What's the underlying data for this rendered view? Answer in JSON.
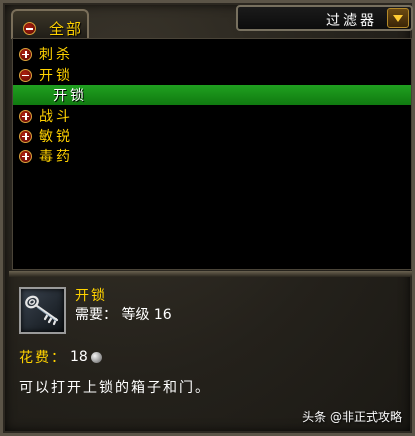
{
  "tab": {
    "label": "全部"
  },
  "filter": {
    "label": "过滤器"
  },
  "categories": [
    {
      "label": "刺杀",
      "state": "collapsed"
    },
    {
      "label": "开锁",
      "state": "expanded"
    },
    {
      "label": "开锁",
      "state": "selected-child"
    },
    {
      "label": "战斗",
      "state": "collapsed"
    },
    {
      "label": "敏锐",
      "state": "collapsed"
    },
    {
      "label": "毒药",
      "state": "collapsed"
    }
  ],
  "detail": {
    "name": "开锁",
    "requirement": "需要： 等级 16",
    "cost_label": "花费：",
    "cost_value": "18",
    "description": "可以打开上锁的箱子和门。"
  },
  "watermark": "头条 @非正式攻略",
  "colors": {
    "gold_text": "#ffd200",
    "selection_green": "#20a020"
  }
}
